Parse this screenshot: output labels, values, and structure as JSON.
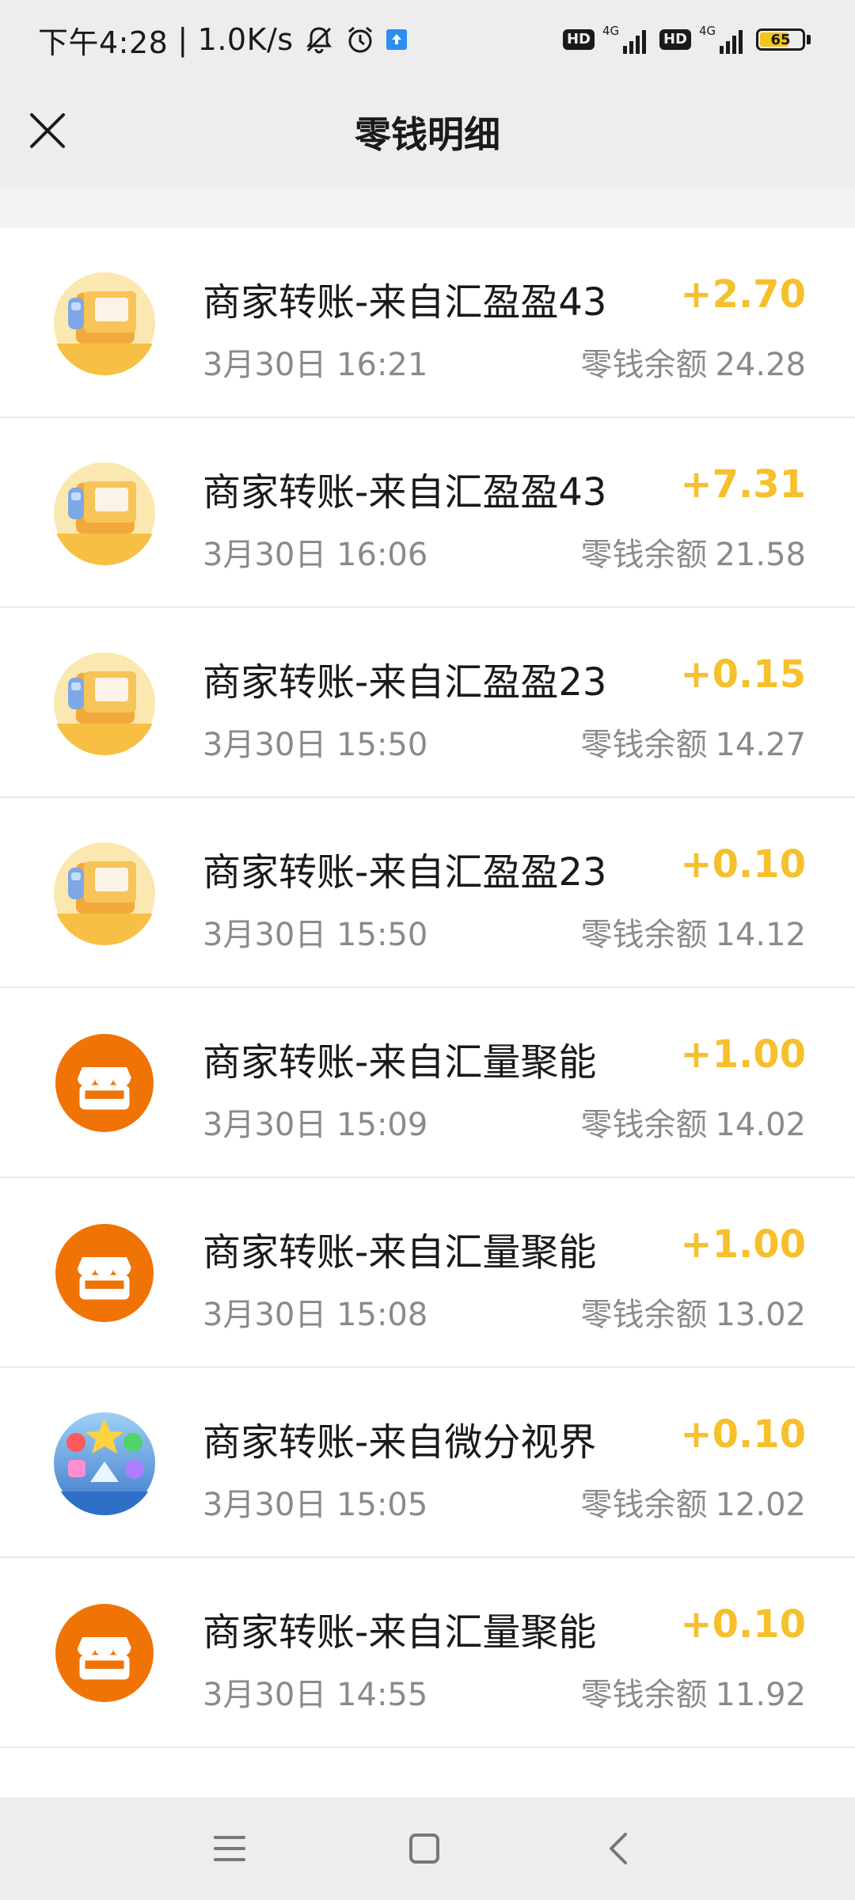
{
  "status_bar": {
    "time": "下午4:28",
    "separator": "|",
    "net_speed": "1.0K/s",
    "battery_level": "65",
    "network_1": "4G",
    "network_2": "4G",
    "hd_1": "HD",
    "hd_2": "HD",
    "icons": [
      "mute-bell-icon",
      "alarm-icon",
      "upload-notification-icon",
      "signal-icon",
      "battery-icon"
    ]
  },
  "header": {
    "title": "零钱明细",
    "close_icon": "close-icon"
  },
  "transactions": [
    {
      "name": "商家转账-来自汇盈盈43",
      "amount": "+2.70",
      "time": "3月30日 16:21",
      "balance_label": "零钱余额",
      "balance": "24.28",
      "avatar": "quiz-king-logo"
    },
    {
      "name": "商家转账-来自汇盈盈43",
      "amount": "+7.31",
      "time": "3月30日 16:06",
      "balance_label": "零钱余额",
      "balance": "21.58",
      "avatar": "quiz-king-logo"
    },
    {
      "name": "商家转账-来自汇盈盈23",
      "amount": "+0.15",
      "time": "3月30日 15:50",
      "balance_label": "零钱余额",
      "balance": "14.27",
      "avatar": "quiz-king-logo"
    },
    {
      "name": "商家转账-来自汇盈盈23",
      "amount": "+0.10",
      "time": "3月30日 15:50",
      "balance_label": "零钱余额",
      "balance": "14.12",
      "avatar": "quiz-king-logo"
    },
    {
      "name": "商家转账-来自汇量聚能",
      "amount": "+1.00",
      "time": "3月30日 15:09",
      "balance_label": "零钱余额",
      "balance": "14.02",
      "avatar": "store-icon"
    },
    {
      "name": "商家转账-来自汇量聚能",
      "amount": "+1.00",
      "time": "3月30日 15:08",
      "balance_label": "零钱余额",
      "balance": "13.02",
      "avatar": "store-icon"
    },
    {
      "name": "商家转账-来自微分视界",
      "amount": "+0.10",
      "time": "3月30日 15:05",
      "balance_label": "零钱余额",
      "balance": "12.02",
      "avatar": "ice-match-game-logo"
    },
    {
      "name": "商家转账-来自汇量聚能",
      "amount": "+0.10",
      "time": "3月30日 14:55",
      "balance_label": "零钱余额",
      "balance": "11.92",
      "avatar": "store-icon"
    }
  ],
  "colors": {
    "amount": "#f6c02d",
    "store_avatar": "#f07305",
    "header_bg": "#ededed",
    "secondary_text": "#8a8a8a"
  },
  "nav_bar": {
    "icons": [
      "menu-icon",
      "home-icon",
      "back-icon"
    ]
  }
}
